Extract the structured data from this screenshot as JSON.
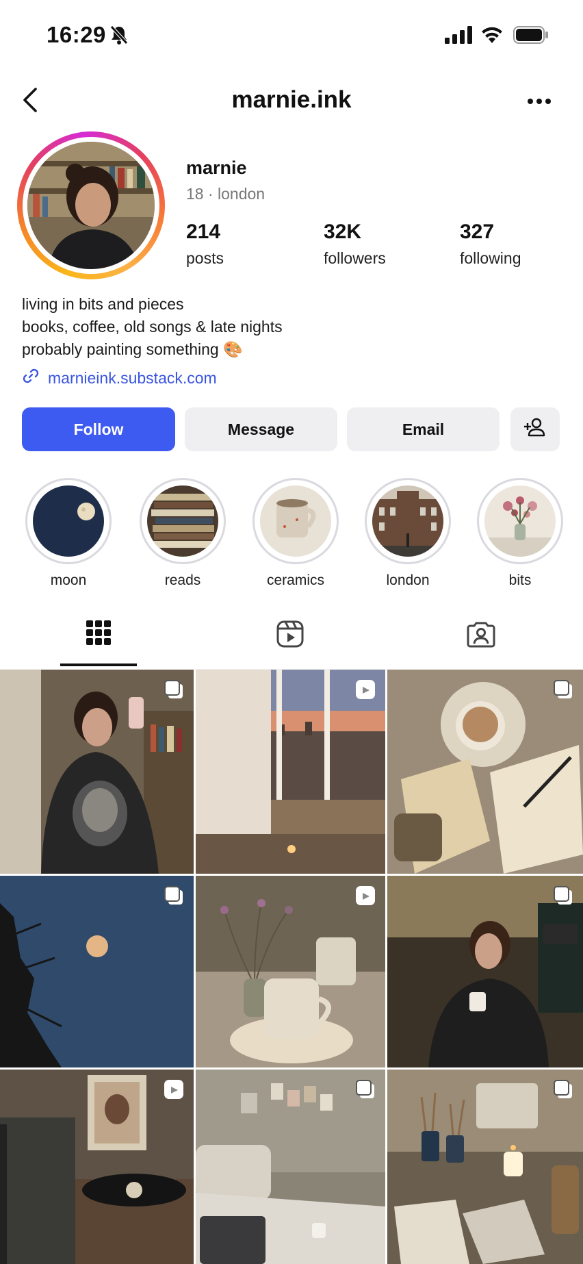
{
  "status_bar": {
    "time": "16:29",
    "icons": [
      "bell-slash-icon",
      "signal-icon",
      "wifi-icon",
      "battery-icon"
    ]
  },
  "header": {
    "username": "marnie.ink",
    "back_icon": "chevron-left-icon",
    "more_icon": "ellipsis-icon"
  },
  "profile": {
    "display_name": "marnie",
    "subtitle": "18 · london",
    "stats": [
      {
        "value": "214",
        "label": "posts"
      },
      {
        "value": "32K",
        "label": "followers"
      },
      {
        "value": "327",
        "label": "following"
      }
    ],
    "bio": [
      "living in bits and pieces",
      "books, coffee, old songs & late nights",
      "probably painting something 🎨"
    ],
    "link": "marnieink.substack.com"
  },
  "buttons": {
    "follow": "Follow",
    "message": "Message",
    "email": "Email",
    "add_friend_icon": "person-plus-icon"
  },
  "highlights": [
    {
      "label": "moon"
    },
    {
      "label": "reads"
    },
    {
      "label": "ceramics"
    },
    {
      "label": "london"
    },
    {
      "label": "bits"
    }
  ],
  "tabs": [
    {
      "icon": "grid-icon",
      "active": true
    },
    {
      "icon": "reels-icon",
      "active": false
    },
    {
      "icon": "tagged-icon",
      "active": false
    }
  ],
  "grid": [
    {
      "subject": "mirror selfie",
      "badge": "multi"
    },
    {
      "subject": "window sunset",
      "badge": "reel"
    },
    {
      "subject": "coffee and journal",
      "badge": "multi"
    },
    {
      "subject": "full moon",
      "badge": "multi"
    },
    {
      "subject": "ceramic mug",
      "badge": "reel"
    },
    {
      "subject": "girl with headphones",
      "badge": "multi"
    },
    {
      "subject": "record player",
      "badge": "reel"
    },
    {
      "subject": "bedroom laptop",
      "badge": "multi"
    },
    {
      "subject": "art desk",
      "badge": "multi"
    }
  ],
  "colors": {
    "accent": "#3d5af1",
    "link": "#3a55e0",
    "button_gray": "#efeff2"
  }
}
